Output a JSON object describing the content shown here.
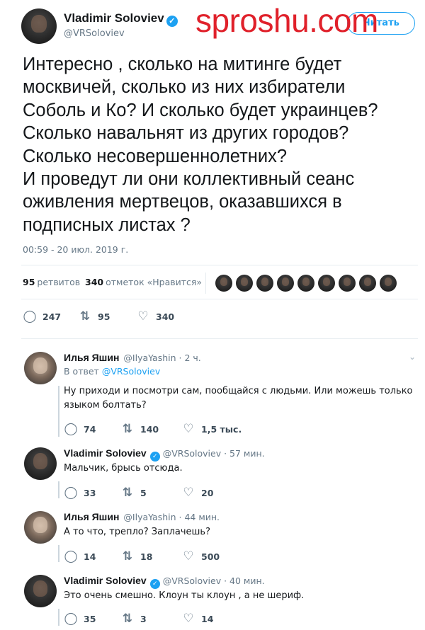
{
  "watermark": "sproshu.com",
  "tweet": {
    "author": "Vladimir Soloviev",
    "handle": "@VRSoloviev",
    "follow_label": "Читать",
    "text": "Интересно , сколько на митинге будет\nмосквичей, сколько из них избиратели\nСоболь и Ко? И сколько будет украинцев?\nСколько навальнят из других городов?\nСколько несовершеннолетних?\nИ проведут ли они коллективный сеанс\nоживления мертвецов, оказавшихся в\nподписных листах ?",
    "time": "00:59 - 20 июл. 2019 г.",
    "retweets_count": "95",
    "retweets_label": "ретвитов",
    "likes_count": "340",
    "likes_label": "отметок «Нравится»",
    "actions": {
      "replies": "247",
      "retweets": "95",
      "likes": "340"
    }
  },
  "replies": [
    {
      "name": "Илья Яшин",
      "handle": "@IlyaYashin · 2 ч.",
      "in_reply_prefix": "В ответ",
      "in_reply_handle": "@VRSoloviev",
      "text": "Ну приходи и посмотри сам, пообщайся с людьми. Или можешь только языком болтать?",
      "replies": "74",
      "retweets": "140",
      "likes": "1,5 тыс."
    },
    {
      "name": "Vladimir Soloviev",
      "handle": "@VRSoloviev · 57 мин.",
      "text": "Мальчик, брысь отсюда.",
      "replies": "33",
      "retweets": "5",
      "likes": "20"
    },
    {
      "name": "Илья Яшин",
      "handle": "@IlyaYashin · 44 мин.",
      "text": "А то что, трепло? Заплачешь?",
      "replies": "14",
      "retweets": "18",
      "likes": "500"
    },
    {
      "name": "Vladimir Soloviev",
      "handle": "@VRSoloviev · 40 мин.",
      "text": "Это очень смешно. Клоун ты клоун , а не шериф.",
      "replies": "35",
      "retweets": "3",
      "likes": "14"
    }
  ],
  "colors": {
    "accent": "#1da1f2",
    "text": "#14171a",
    "muted": "#657786",
    "watermark": "#e0212b"
  },
  "icons": {
    "reply": "reply-icon",
    "retweet": "retweet-icon",
    "like": "heart-icon",
    "verified": "verified-badge-icon",
    "more": "chevron-down-icon"
  }
}
